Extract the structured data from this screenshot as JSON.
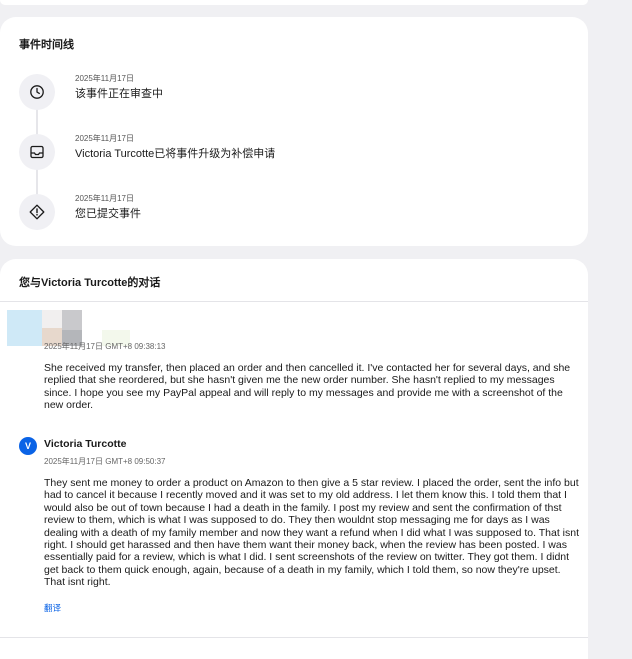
{
  "timeline": {
    "title": "事件时间线",
    "items": [
      {
        "icon": "clock-icon",
        "date": "2025年11月17日",
        "text": "该事件正在审查中"
      },
      {
        "icon": "inbox-icon",
        "date": "2025年11月17日",
        "text": "Victoria Turcotte已将事件升级为补偿申请"
      },
      {
        "icon": "alert-icon",
        "date": "2025年11月17日",
        "text": "您已提交事件"
      }
    ]
  },
  "conversation": {
    "title": "您与Victoria Turcotte的对话",
    "messages": [
      {
        "sender": "",
        "time": "2025年11月17日 GMT+8 09:38:13",
        "body": "She received my transfer, then placed an order and then cancelled it. I've contacted her for several days, and she replied that she reordered, but she hasn't given me the new order number. She hasn't replied to my messages since. I hope you see my PayPal appeal and will reply to my messages and provide me with a screenshot of the new order."
      },
      {
        "sender": "Victoria Turcotte",
        "avatar_initial": "V",
        "time": "2025年11月17日 GMT+8 09:50:37",
        "body": "They sent me money to order a product on Amazon to then give a 5 star review. I placed the order, sent the info but had to cancel it because I recently moved and it was set to my old address. I let them know this. I told them that I would also be out of town because I had a death in the family. I post my review and sent the confirmation of thst review to them, which is what I was supposed to do. They then wouldnt stop messaging me for days as I was dealing with a death of my family member and now they want a refund when I did what I was supposed to. That isnt right. I should get harassed and then have them want their money back, when the review has been posted. I was essentially paid for a review, which is what I did. I sent screenshots of the review on twitter. They got them. I didnt get back to them quick enough, again, because of a death in my family, which I told them, so now they're upset. That isnt right.",
        "translate_label": "翻译"
      }
    ]
  },
  "colors": {
    "accent": "#0a63e6",
    "background": "#f0f0f3",
    "card": "#ffffff"
  }
}
